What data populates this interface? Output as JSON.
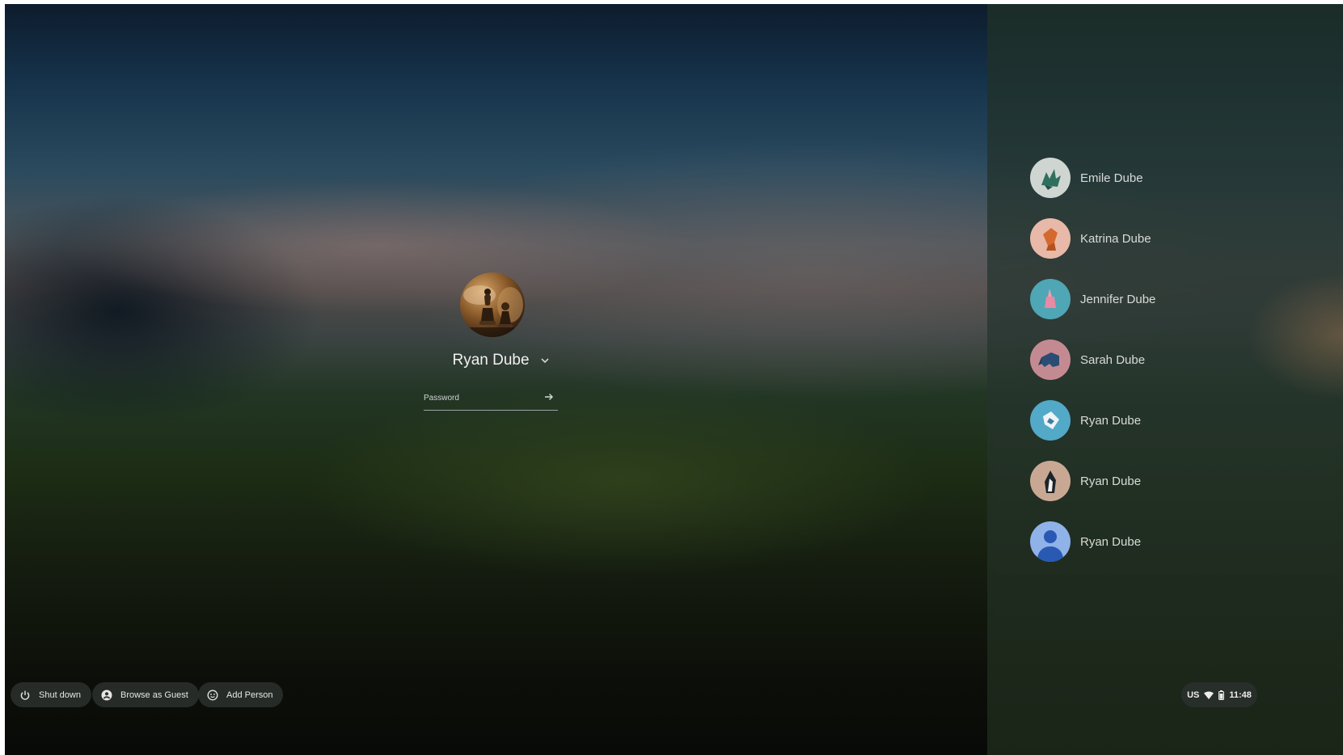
{
  "pod": {
    "user_name": "Ryan Dube",
    "password_placeholder": "Password"
  },
  "users": [
    {
      "name": "Emile Dube",
      "icon": "origami-dragon-avatar",
      "bg": "#cfd6d2"
    },
    {
      "name": "Katrina Dube",
      "icon": "origami-fox-avatar",
      "bg": "#e8b9a8"
    },
    {
      "name": "Jennifer Dube",
      "icon": "origami-rabbit-avatar",
      "bg": "#4fa6b5"
    },
    {
      "name": "Sarah Dube",
      "icon": "origami-elephant-avatar",
      "bg": "#c48a92"
    },
    {
      "name": "Ryan Dube",
      "icon": "origami-fish-avatar",
      "bg": "#52a9c8"
    },
    {
      "name": "Ryan Dube",
      "icon": "origami-penguin-avatar",
      "bg": "#c9a893"
    },
    {
      "name": "Ryan Dube",
      "icon": "default-person-avatar",
      "bg": "#8fb2e8"
    }
  ],
  "shelf": {
    "shutdown_label": "Shut down",
    "guest_label": "Browse as Guest",
    "add_person_label": "Add Person"
  },
  "tray": {
    "keyboard_layout": "US",
    "time": "11:48"
  }
}
